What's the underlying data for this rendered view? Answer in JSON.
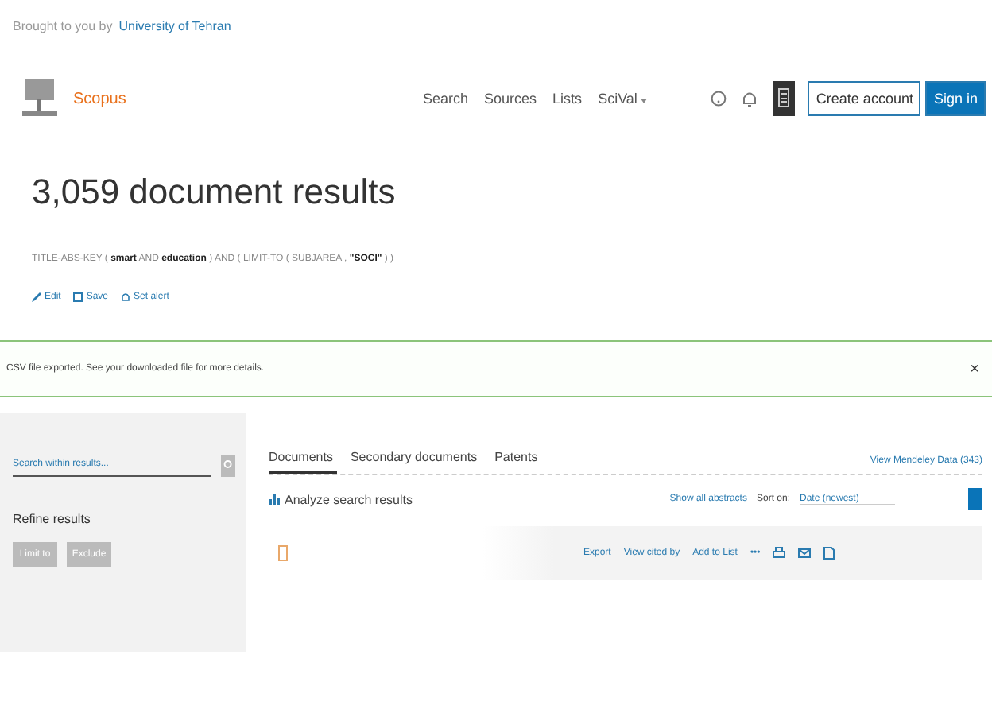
{
  "institution": {
    "prefix": "Brought to you by",
    "name": "University of Tehran"
  },
  "header": {
    "brand": "Scopus",
    "nav": [
      {
        "label": "Search",
        "dropdown": false
      },
      {
        "label": "Sources",
        "dropdown": false
      },
      {
        "label": "Lists",
        "dropdown": false
      },
      {
        "label": "SciVal",
        "dropdown": true
      }
    ],
    "buttons": [
      {
        "label": "Create account",
        "kind": "outline"
      },
      {
        "label": "Sign in",
        "kind": "primary"
      }
    ]
  },
  "results": {
    "title": "3,059 document results",
    "query": "TITLE-ABS-KEY ( **smart** AND **education** ) AND ( LIMIT-TO ( SUBJAREA , **\"SOCI\"** ) )",
    "actions": [
      {
        "label": "Edit",
        "kind": "edit"
      },
      {
        "label": "Save",
        "kind": "save"
      },
      {
        "label": "Set alert",
        "kind": "alert"
      }
    ]
  },
  "banner": {
    "message": "CSV file exported. See your downloaded file for more details.",
    "close": "×"
  },
  "sidebar": {
    "search_placeholder": "Search within results...",
    "refine_title": "Refine results",
    "buttons": [
      "Limit to",
      "Exclude"
    ]
  },
  "tabs": [
    {
      "label": "Documents",
      "selected": true
    },
    {
      "label": "Secondary documents",
      "selected": false
    },
    {
      "label": "Patents",
      "selected": false
    }
  ],
  "mendeley_link": "View Mendeley Data (343)",
  "toolbar": {
    "analyze": "Analyze search results",
    "show_abstracts": "Show all abstracts",
    "sort_label": "Sort on:",
    "sort_value": "Date (newest)"
  },
  "select_all": {
    "checked": false
  },
  "row_actions": [
    "Export",
    "View cited by",
    "Add to List",
    "•••"
  ]
}
